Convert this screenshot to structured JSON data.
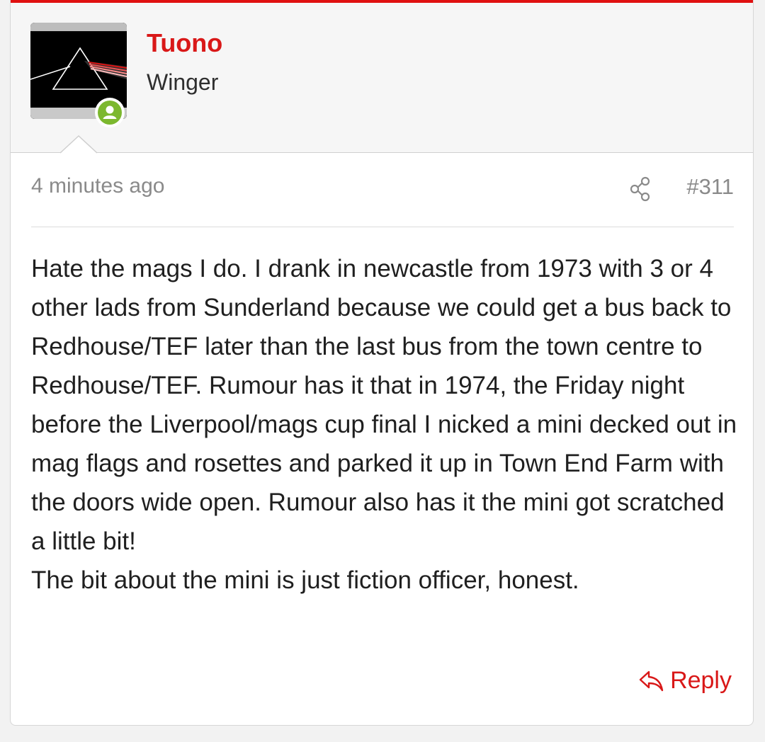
{
  "post": {
    "author": {
      "username": "Tuono",
      "title": "Winger",
      "avatar_description": "prism-artwork",
      "status_icon": "user-online-icon"
    },
    "meta": {
      "timestamp": "4 minutes ago",
      "post_number": "#311",
      "share_icon": "share-icon"
    },
    "body": {
      "paragraph_1": "Hate the mags I do. I drank in newcastle from 1973 with 3 or 4 other lads from Sunderland because we could get a bus back to Redhouse/TEF later than the last bus from the town centre to Redhouse/TEF. Rumour has it that in 1974, the Friday night before the Liverpool/mags cup final I nicked a mini decked out in mag flags and rosettes and parked it up in Town End Farm with the doors wide open. Rumour also has it the mini got scratched a little bit!",
      "paragraph_2": "The bit about the mini is just fiction officer, honest."
    },
    "actions": {
      "reply_label": "Reply",
      "reply_icon": "reply-icon"
    }
  },
  "colors": {
    "accent": "#d91818",
    "online": "#7cb82f",
    "meta_text": "#8a8a8a"
  }
}
